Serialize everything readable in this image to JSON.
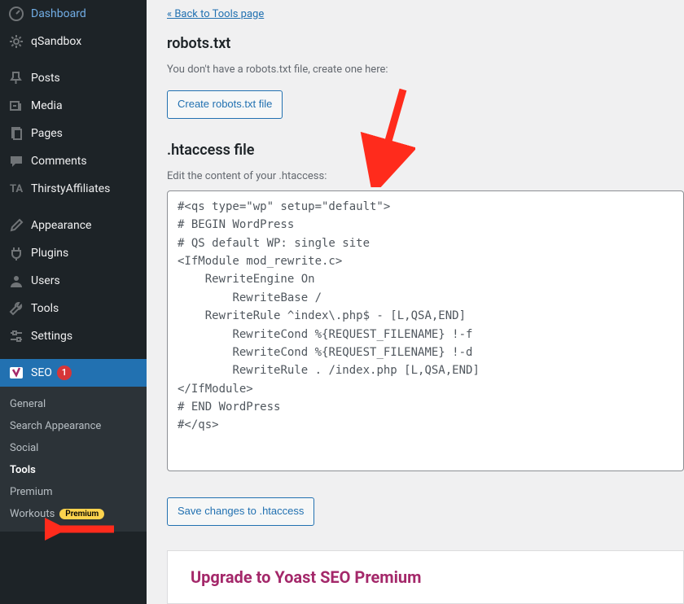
{
  "sidebar": {
    "items": [
      {
        "label": "Dashboard",
        "icon": "dashboard"
      },
      {
        "label": "qSandbox",
        "icon": "gear"
      },
      {
        "sep": true
      },
      {
        "label": "Posts",
        "icon": "pin"
      },
      {
        "label": "Media",
        "icon": "media"
      },
      {
        "label": "Pages",
        "icon": "pages"
      },
      {
        "label": "Comments",
        "icon": "comment"
      },
      {
        "label": "ThirstyAffiliates",
        "icon": "ta"
      },
      {
        "sep": true
      },
      {
        "label": "Appearance",
        "icon": "brush"
      },
      {
        "label": "Plugins",
        "icon": "plug"
      },
      {
        "label": "Users",
        "icon": "user"
      },
      {
        "label": "Tools",
        "icon": "wrench"
      },
      {
        "label": "Settings",
        "icon": "sliders"
      },
      {
        "sep": true
      },
      {
        "label": "SEO",
        "icon": "yoast",
        "active": true,
        "count": "1"
      }
    ],
    "submenu": [
      {
        "label": "General"
      },
      {
        "label": "Search Appearance"
      },
      {
        "label": "Social"
      },
      {
        "label": "Tools",
        "current": true
      },
      {
        "label": "Premium"
      },
      {
        "label": "Workouts",
        "pill": "Premium"
      }
    ]
  },
  "main": {
    "backlink": "« Back to Tools page",
    "robots_title": "robots.txt",
    "robots_help": "You don't have a robots.txt file, create one here:",
    "robots_button": "Create robots.txt file",
    "htaccess_title": ".htaccess file",
    "htaccess_help": "Edit the content of your .htaccess:",
    "htaccess_content": "#<qs type=\"wp\" setup=\"default\">\n# BEGIN WordPress\n# QS default WP: single site\n<IfModule mod_rewrite.c>\n    RewriteEngine On\n        RewriteBase /\n    RewriteRule ^index\\.php$ - [L,QSA,END]\n        RewriteCond %{REQUEST_FILENAME} !-f\n        RewriteCond %{REQUEST_FILENAME} !-d\n        RewriteRule . /index.php [L,QSA,END]\n</IfModule>\n# END WordPress\n#</qs>",
    "htaccess_save": "Save changes to .htaccess",
    "upsell_title": "Upgrade to Yoast SEO Premium"
  }
}
